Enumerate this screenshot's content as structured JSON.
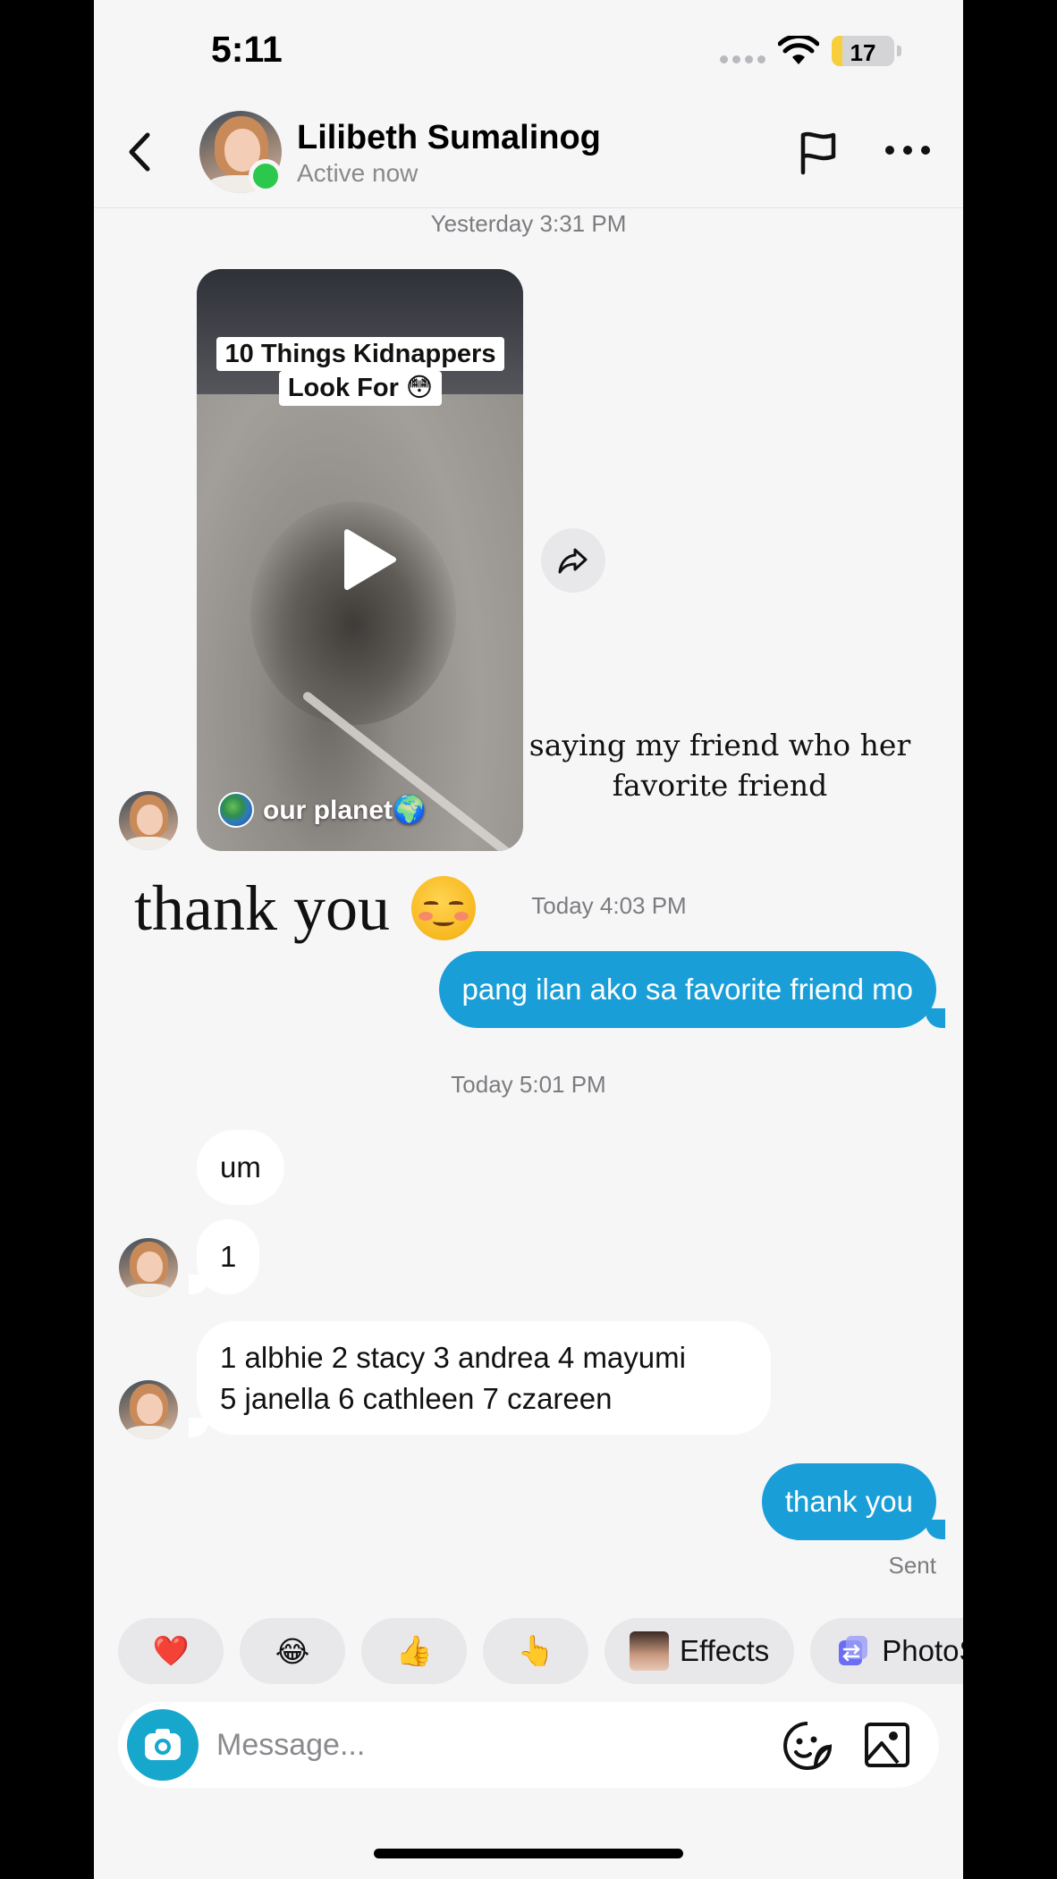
{
  "status_bar": {
    "time": "5:11",
    "battery": "17",
    "battery_level": 0.17
  },
  "header": {
    "name": "Lilibeth Sumalinog",
    "status": "Active now"
  },
  "timestamps": {
    "first": "Yesterday 3:31 PM",
    "second": "Today 4:03 PM",
    "third": "Today 5:01 PM"
  },
  "video": {
    "title_line1": "10 Things Kidnappers",
    "title_line2": "Look For 😳",
    "source": "our planet🌍"
  },
  "overlay": {
    "caption_line1": "saying my friend who her",
    "caption_line2": "favorite friend",
    "thanks": "thank you"
  },
  "messages": {
    "out1": "pang ilan ako sa favorite friend mo",
    "in1": "um",
    "in2": "1",
    "in3_line1": "1 albhie 2 stacy 3 andrea 4 mayumi",
    "in3_line2": "5 janella 6 cathleen 7 czareen",
    "out2": "thank you",
    "status": "Sent"
  },
  "quick_replies": [
    {
      "label": "❤️"
    },
    {
      "label": "😂"
    },
    {
      "label": "👍"
    },
    {
      "label": "👆"
    },
    {
      "label": "Effects"
    },
    {
      "label": "PhotoS"
    }
  ],
  "composer": {
    "placeholder": "Message..."
  },
  "colors": {
    "outgoing_bubble": "#1a9ed8",
    "online": "#2cc84d",
    "camera": "#18a7cc"
  }
}
